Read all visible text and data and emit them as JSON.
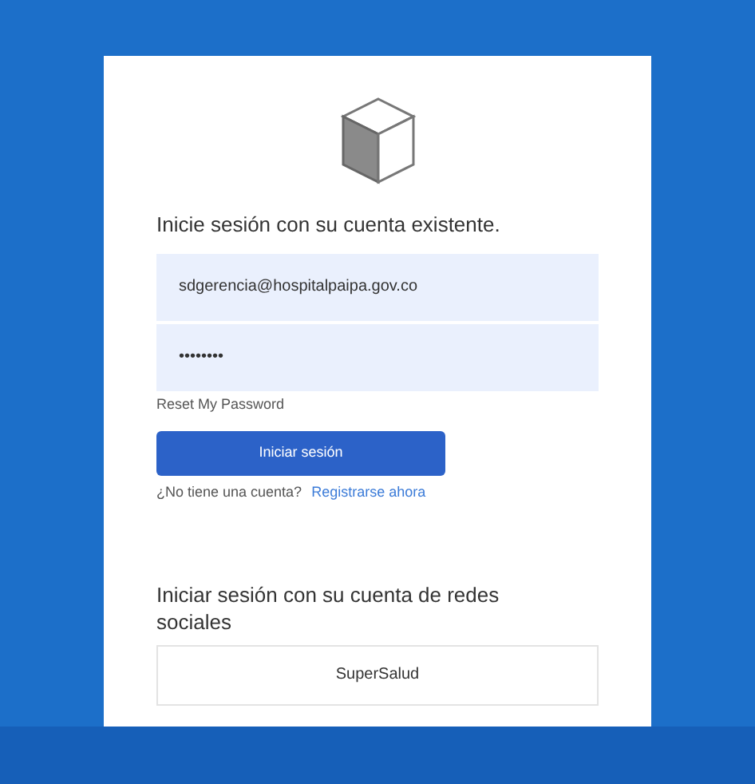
{
  "heading": "Inicie sesión con su cuenta existente.",
  "email": {
    "value": "sdgerencia@hospitalpaipa.gov.co"
  },
  "password": {
    "value": "••••••••"
  },
  "reset_link": "Reset My Password",
  "submit_button": "Iniciar sesión",
  "signup": {
    "prompt": "¿No tiene una cuenta?",
    "link": "Registrarse ahora"
  },
  "social_heading": "Iniciar sesión con su cuenta de redes sociales",
  "social_buttons": [
    "SuperSalud"
  ]
}
